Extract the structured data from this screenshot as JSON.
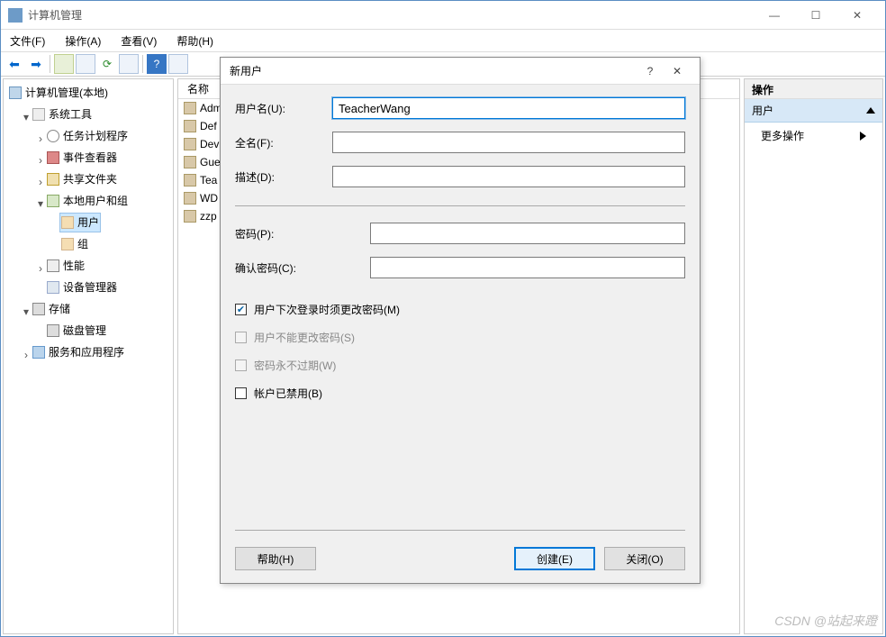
{
  "window": {
    "title": "计算机管理"
  },
  "menu": {
    "file": "文件(F)",
    "action": "操作(A)",
    "view": "查看(V)",
    "help": "帮助(H)"
  },
  "tree": {
    "root": "计算机管理(本地)",
    "system_tools": "系统工具",
    "task_scheduler": "任务计划程序",
    "event_viewer": "事件查看器",
    "shared_folders": "共享文件夹",
    "local_users_groups": "本地用户和组",
    "users": "用户",
    "groups": "组",
    "performance": "性能",
    "device_manager": "设备管理器",
    "storage": "存储",
    "disk_management": "磁盘管理",
    "services_apps": "服务和应用程序"
  },
  "list": {
    "header_name": "名称",
    "items": [
      "Adm",
      "Def",
      "Dev",
      "Gue",
      "Tea",
      "WD",
      "zzp"
    ]
  },
  "actions": {
    "header": "操作",
    "section": "用户",
    "more": "更多操作"
  },
  "dialog": {
    "title": "新用户",
    "username_label": "用户名(U):",
    "username_value": "TeacherWang",
    "fullname_label": "全名(F):",
    "description_label": "描述(D):",
    "password_label": "密码(P):",
    "confirm_password_label": "确认密码(C):",
    "chk_must_change": "用户下次登录时须更改密码(M)",
    "chk_cannot_change": "用户不能更改密码(S)",
    "chk_never_expires": "密码永不过期(W)",
    "chk_disabled": "帐户已禁用(B)",
    "btn_help": "帮助(H)",
    "btn_create": "创建(E)",
    "btn_close": "关闭(O)"
  },
  "watermark": "CSDN @站起来蹬"
}
